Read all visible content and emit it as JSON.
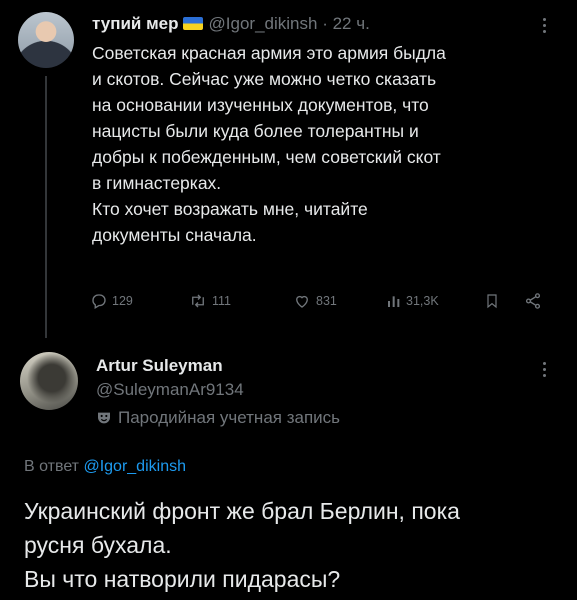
{
  "tweet": {
    "author_name": "тупий мер",
    "handle": "@Igor_dikinsh",
    "separator": "·",
    "time": "22 ч.",
    "lines": [
      "Советская красная армия это армия быдла",
      "и скотов. Сейчас уже можно четко сказать",
      "на основании изученных документов, что",
      "нацисты были куда более толерантны и",
      "добры к побежденным, чем советский скот",
      "в гимнастерках.",
      "Кто хочет возражать мне, читайте",
      "документы сначала."
    ],
    "stats": {
      "replies": "129",
      "retweets": "111",
      "likes": "831",
      "views": "31,3K"
    }
  },
  "reply": {
    "author_name": "Artur Suleyman",
    "handle": "@SuleymanAr9134",
    "badge_text": "Пародийная учетная запись",
    "reply_to_prefix": "В ответ",
    "reply_to_handle": "@Igor_dikinsh",
    "lines": [
      "Украинский фронт же брал Берлин, пока",
      "русня бухала.",
      "Вы что натворили пидарасы?"
    ]
  },
  "icons": {
    "flag": "ukraine-flag-icon",
    "reply": "reply-icon",
    "retweet": "retweet-icon",
    "like": "heart-icon",
    "views": "views-icon",
    "bookmark": "bookmark-icon",
    "share": "share-icon",
    "more": "more-icon",
    "parody": "parody-mask-icon"
  },
  "colors": {
    "background": "#000000",
    "text": "#e7e9ea",
    "muted": "#71767b",
    "link": "#1d9bf0",
    "flag_blue": "#2b6fd6",
    "flag_yellow": "#f5d320"
  }
}
